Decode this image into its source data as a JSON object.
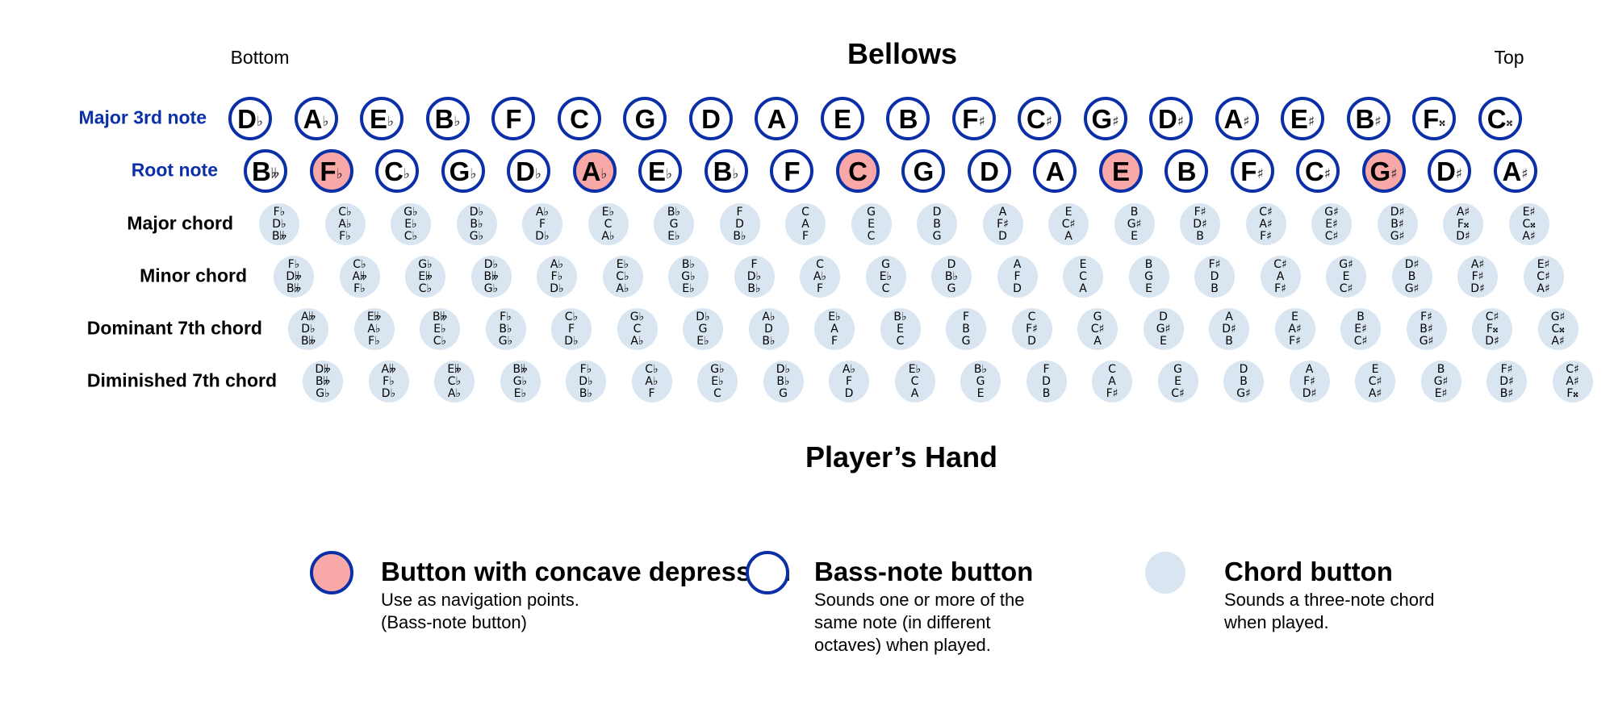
{
  "header": {
    "title": "Bellows",
    "left_label": "Bottom",
    "right_label": "Top"
  },
  "footer_title": "Player’s Hand",
  "colors": {
    "bass_border": "#0a2fa6",
    "concave_fill": "#f9a8a8",
    "chord_fill": "#d9e5f1",
    "label_blue": "#0a2fa6"
  },
  "rows": {
    "major3rd": {
      "label": "Major 3rd note",
      "notes": [
        [
          "D",
          "♭"
        ],
        [
          "A",
          "♭"
        ],
        [
          "E",
          "♭"
        ],
        [
          "B",
          "♭"
        ],
        [
          "F",
          ""
        ],
        [
          "C",
          ""
        ],
        [
          "G",
          ""
        ],
        [
          "D",
          ""
        ],
        [
          "A",
          ""
        ],
        [
          "E",
          ""
        ],
        [
          "B",
          ""
        ],
        [
          "F",
          "♯"
        ],
        [
          "C",
          "♯"
        ],
        [
          "G",
          "♯"
        ],
        [
          "D",
          "♯"
        ],
        [
          "A",
          "♯"
        ],
        [
          "E",
          "♯"
        ],
        [
          "B",
          "♯"
        ],
        [
          "F",
          "𝄪"
        ],
        [
          "C",
          "𝄪"
        ]
      ]
    },
    "root": {
      "label": "Root note",
      "notes": [
        [
          "B",
          "𝄫"
        ],
        [
          "F",
          "♭"
        ],
        [
          "C",
          "♭"
        ],
        [
          "G",
          "♭"
        ],
        [
          "D",
          "♭"
        ],
        [
          "A",
          "♭"
        ],
        [
          "E",
          "♭"
        ],
        [
          "B",
          "♭"
        ],
        [
          "F",
          ""
        ],
        [
          "C",
          ""
        ],
        [
          "G",
          ""
        ],
        [
          "D",
          ""
        ],
        [
          "A",
          ""
        ],
        [
          "E",
          ""
        ],
        [
          "B",
          ""
        ],
        [
          "F",
          "♯"
        ],
        [
          "C",
          "♯"
        ],
        [
          "G",
          "♯"
        ],
        [
          "D",
          "♯"
        ],
        [
          "A",
          "♯"
        ]
      ],
      "concave_indexes": [
        1,
        5,
        9,
        13,
        17
      ]
    },
    "major": {
      "label": "Major chord",
      "chords": [
        [
          "F♭",
          "D♭",
          "B𝄫"
        ],
        [
          "C♭",
          "A♭",
          "F♭"
        ],
        [
          "G♭",
          "E♭",
          "C♭"
        ],
        [
          "D♭",
          "B♭",
          "G♭"
        ],
        [
          "A♭",
          "F",
          "D♭"
        ],
        [
          "E♭",
          "C",
          "A♭"
        ],
        [
          "B♭",
          "G",
          "E♭"
        ],
        [
          "F",
          "D",
          "B♭"
        ],
        [
          "C",
          "A",
          "F"
        ],
        [
          "G",
          "E",
          "C"
        ],
        [
          "D",
          "B",
          "G"
        ],
        [
          "A",
          "F♯",
          "D"
        ],
        [
          "E",
          "C♯",
          "A"
        ],
        [
          "B",
          "G♯",
          "E"
        ],
        [
          "F♯",
          "D♯",
          "B"
        ],
        [
          "C♯",
          "A♯",
          "F♯"
        ],
        [
          "G♯",
          "E♯",
          "C♯"
        ],
        [
          "D♯",
          "B♯",
          "G♯"
        ],
        [
          "A♯",
          "F𝄪",
          "D♯"
        ],
        [
          "E♯",
          "C𝄪",
          "A♯"
        ]
      ]
    },
    "minor": {
      "label": "Minor chord",
      "chords": [
        [
          "F♭",
          "D𝄫",
          "B𝄫"
        ],
        [
          "C♭",
          "A𝄫",
          "F♭"
        ],
        [
          "G♭",
          "E𝄫",
          "C♭"
        ],
        [
          "D♭",
          "B𝄫",
          "G♭"
        ],
        [
          "A♭",
          "F♭",
          "D♭"
        ],
        [
          "E♭",
          "C♭",
          "A♭"
        ],
        [
          "B♭",
          "G♭",
          "E♭"
        ],
        [
          "F",
          "D♭",
          "B♭"
        ],
        [
          "C",
          "A♭",
          "F"
        ],
        [
          "G",
          "E♭",
          "C"
        ],
        [
          "D",
          "B♭",
          "G"
        ],
        [
          "A",
          "F",
          "D"
        ],
        [
          "E",
          "C",
          "A"
        ],
        [
          "B",
          "G",
          "E"
        ],
        [
          "F♯",
          "D",
          "B"
        ],
        [
          "C♯",
          "A",
          "F♯"
        ],
        [
          "G♯",
          "E",
          "C♯"
        ],
        [
          "D♯",
          "B",
          "G♯"
        ],
        [
          "A♯",
          "F♯",
          "D♯"
        ],
        [
          "E♯",
          "C♯",
          "A♯"
        ]
      ]
    },
    "dominant7": {
      "label": "Dominant 7th chord",
      "chords": [
        [
          "A𝄫",
          "D♭",
          "B𝄫"
        ],
        [
          "E𝄫",
          "A♭",
          "F♭"
        ],
        [
          "B𝄫",
          "E♭",
          "C♭"
        ],
        [
          "F♭",
          "B♭",
          "G♭"
        ],
        [
          "C♭",
          "F",
          "D♭"
        ],
        [
          "G♭",
          "C",
          "A♭"
        ],
        [
          "D♭",
          "G",
          "E♭"
        ],
        [
          "A♭",
          "D",
          "B♭"
        ],
        [
          "E♭",
          "A",
          "F"
        ],
        [
          "B♭",
          "E",
          "C"
        ],
        [
          "F",
          "B",
          "G"
        ],
        [
          "C",
          "F♯",
          "D"
        ],
        [
          "G",
          "C♯",
          "A"
        ],
        [
          "D",
          "G♯",
          "E"
        ],
        [
          "A",
          "D♯",
          "B"
        ],
        [
          "E",
          "A♯",
          "F♯"
        ],
        [
          "B",
          "E♯",
          "C♯"
        ],
        [
          "F♯",
          "B♯",
          "G♯"
        ],
        [
          "C♯",
          "F𝄪",
          "D♯"
        ],
        [
          "G♯",
          "C𝄪",
          "A♯"
        ]
      ]
    },
    "diminished7": {
      "label": "Diminished 7th chord",
      "chords": [
        [
          "D𝄫",
          "B𝄫",
          "G♭"
        ],
        [
          "A𝄫",
          "F♭",
          "D♭"
        ],
        [
          "E𝄫",
          "C♭",
          "A♭"
        ],
        [
          "B𝄫",
          "G♭",
          "E♭"
        ],
        [
          "F♭",
          "D♭",
          "B♭"
        ],
        [
          "C♭",
          "A♭",
          "F"
        ],
        [
          "G♭",
          "E♭",
          "C"
        ],
        [
          "D♭",
          "B♭",
          "G"
        ],
        [
          "A♭",
          "F",
          "D"
        ],
        [
          "E♭",
          "C",
          "A"
        ],
        [
          "B♭",
          "G",
          "E"
        ],
        [
          "F",
          "D",
          "B"
        ],
        [
          "C",
          "A",
          "F♯"
        ],
        [
          "G",
          "E",
          "C♯"
        ],
        [
          "D",
          "B",
          "G♯"
        ],
        [
          "A",
          "F♯",
          "D♯"
        ],
        [
          "E",
          "C♯",
          "A♯"
        ],
        [
          "B",
          "G♯",
          "E♯"
        ],
        [
          "F♯",
          "D♯",
          "B♯"
        ],
        [
          "C♯",
          "A♯",
          "F𝄪"
        ]
      ]
    }
  },
  "legend": [
    {
      "key": "concave",
      "title": "Button with concave depression",
      "desc": [
        "Use as navigation points.",
        "(Bass-note button)"
      ]
    },
    {
      "key": "bass",
      "title": "Bass-note button",
      "desc": [
        "Sounds one or more of the",
        "same note (in different",
        "octaves) when played."
      ]
    },
    {
      "key": "chord",
      "title": "Chord button",
      "desc": [
        "Sounds a three-note chord",
        "when played."
      ]
    }
  ]
}
